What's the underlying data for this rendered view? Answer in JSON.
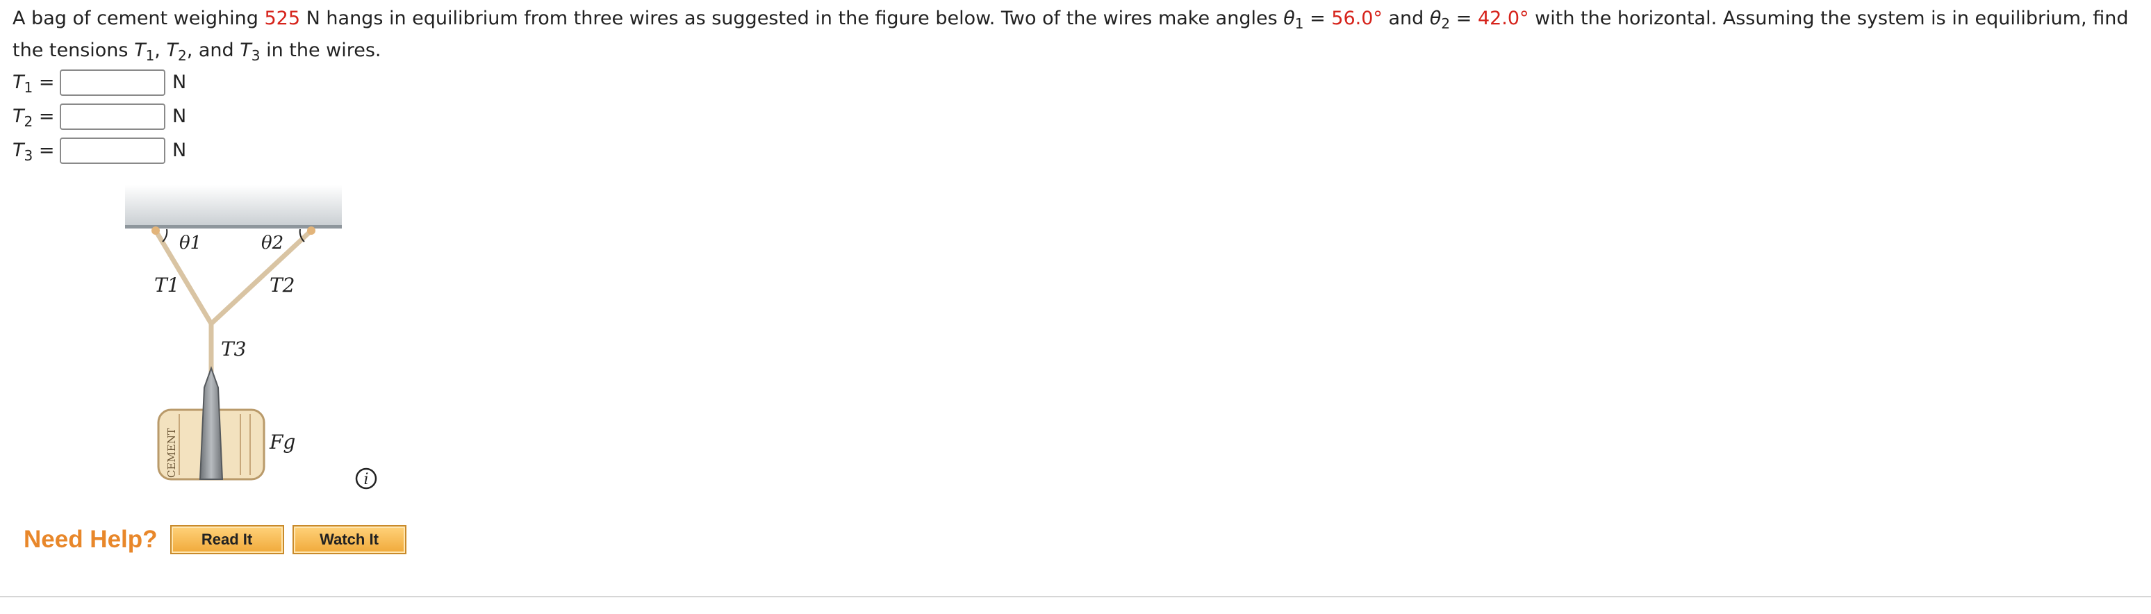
{
  "problem": {
    "text_a": "A bag of cement weighing ",
    "weight": "525",
    "text_b": " N hangs in equilibrium from three wires as suggested in the figure below. Two of the wires make angles ",
    "theta": "θ",
    "sub1": "1",
    "eq": " = ",
    "angle1": "56.0°",
    "and": " and ",
    "sub2": "2",
    "angle2": "42.0°",
    "text_c": " with the horizontal. Assuming the system is in equilibrium, find the tensions ",
    "T": "T",
    "sub3": "3",
    "comma": ", ",
    "text_d": ", and ",
    "text_e": " in the wires."
  },
  "answers": [
    {
      "var": "T",
      "sub": "1",
      "eq": " =",
      "value": "",
      "unit": "N"
    },
    {
      "var": "T",
      "sub": "2",
      "eq": " =",
      "value": "",
      "unit": "N"
    },
    {
      "var": "T",
      "sub": "3",
      "eq": " =",
      "value": "",
      "unit": "N"
    }
  ],
  "figure": {
    "theta_1": "θ1",
    "theta_2": "θ2",
    "t1": "T1",
    "t2": "T2",
    "t3": "T3",
    "fg": "Fg",
    "bag_text": "CEMENT"
  },
  "info_icon": "i",
  "help": {
    "label": "Need Help?",
    "read_it": "Read It",
    "watch_it": "Watch It"
  },
  "colors": {
    "highlight": "#d6231b",
    "help_label": "#e8872a",
    "button": "#f0a93a"
  },
  "icons": {
    "info": "info-icon"
  }
}
